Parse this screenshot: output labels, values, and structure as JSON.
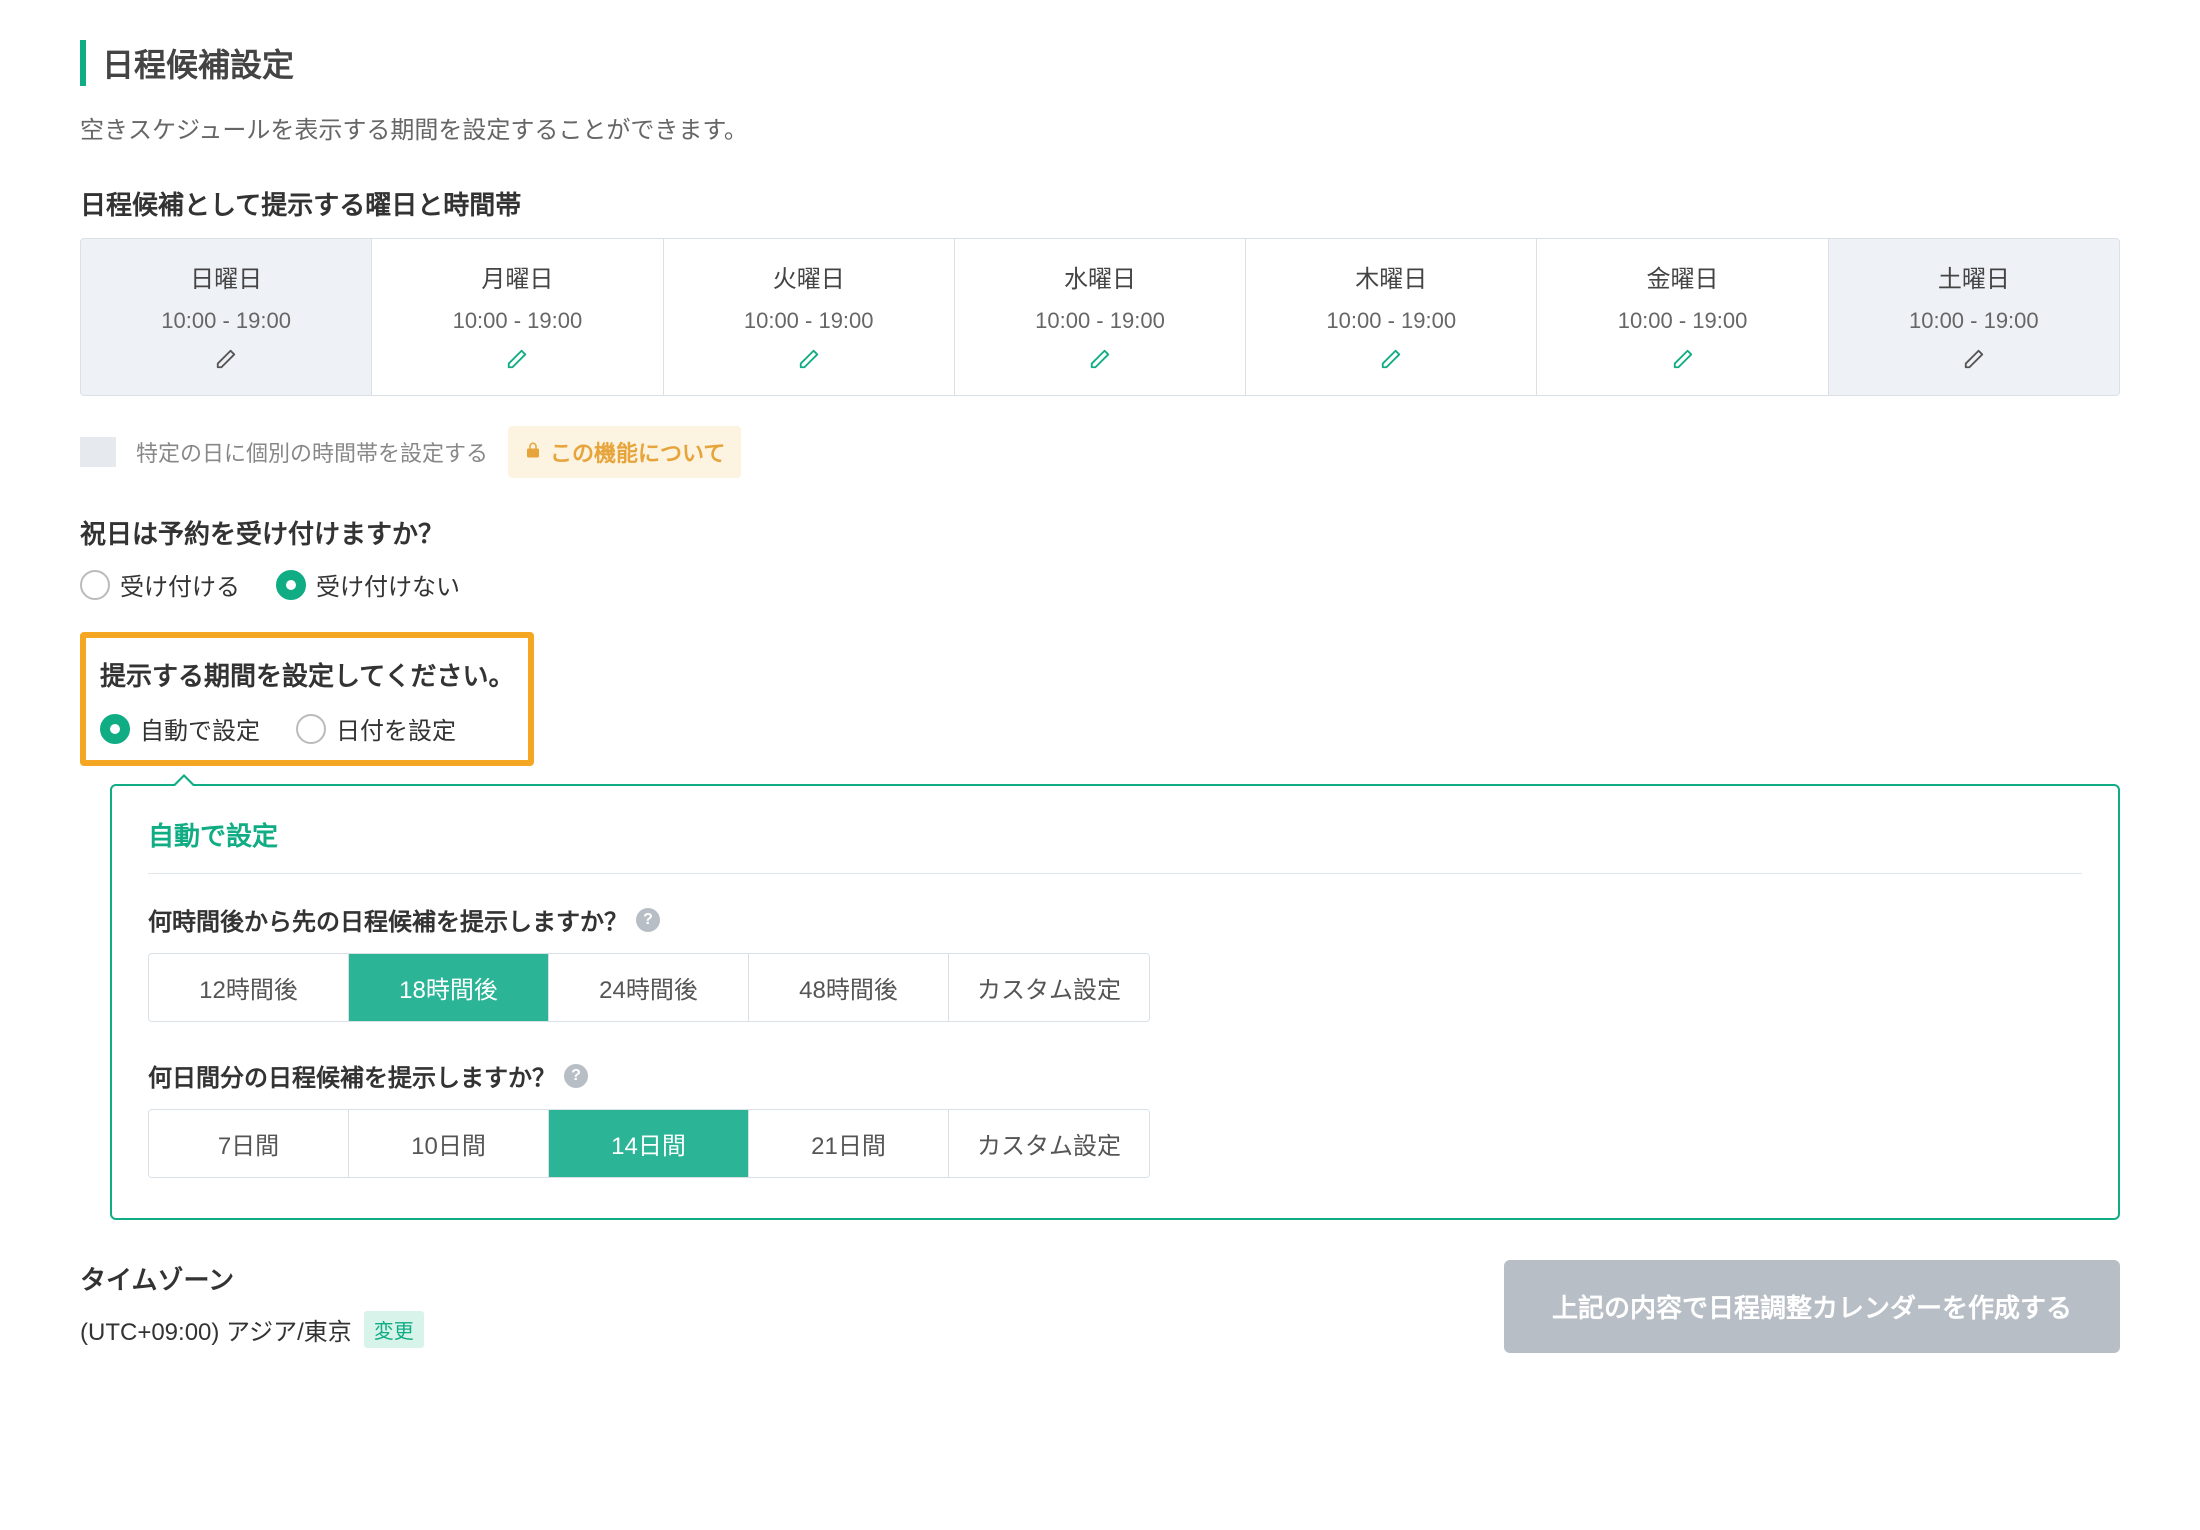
{
  "header": {
    "title": "日程候補設定",
    "description": "空きスケジュールを表示する期間を設定することができます。"
  },
  "week": {
    "heading": "日程候補として提示する曜日と時間帯",
    "days": [
      {
        "name": "日曜日",
        "time": "10:00 - 19:00",
        "weekend": true
      },
      {
        "name": "月曜日",
        "time": "10:00 - 19:00",
        "weekend": false
      },
      {
        "name": "火曜日",
        "time": "10:00 - 19:00",
        "weekend": false
      },
      {
        "name": "水曜日",
        "time": "10:00 - 19:00",
        "weekend": false
      },
      {
        "name": "木曜日",
        "time": "10:00 - 19:00",
        "weekend": false
      },
      {
        "name": "金曜日",
        "time": "10:00 - 19:00",
        "weekend": false
      },
      {
        "name": "土曜日",
        "time": "10:00 - 19:00",
        "weekend": true
      }
    ]
  },
  "specific_day": {
    "label": "特定の日に個別の時間帯を設定する",
    "info_badge": "この機能について"
  },
  "holiday": {
    "heading": "祝日は予約を受け付けますか？",
    "accept_label": "受け付ける",
    "reject_label": "受け付けない",
    "selected": "reject"
  },
  "period_mode": {
    "heading": "提示する期間を設定してください。",
    "auto_label": "自動で設定",
    "date_label": "日付を設定",
    "selected": "auto"
  },
  "auto_panel": {
    "title": "自動で設定",
    "lead_time": {
      "label": "何時間後から先の日程候補を提示しますか？",
      "options": [
        "12時間後",
        "18時間後",
        "24時間後",
        "48時間後",
        "カスタム設定"
      ],
      "selected_index": 1
    },
    "span": {
      "label": "何日間分の日程候補を提示しますか？",
      "options": [
        "7日間",
        "10日間",
        "14日間",
        "21日間",
        "カスタム設定"
      ],
      "selected_index": 2
    }
  },
  "timezone": {
    "heading": "タイムゾーン",
    "value": "(UTC+09:00) アジア/東京",
    "change_label": "変更"
  },
  "submit": {
    "label": "上記の内容で日程調整カレンダーを作成する"
  }
}
